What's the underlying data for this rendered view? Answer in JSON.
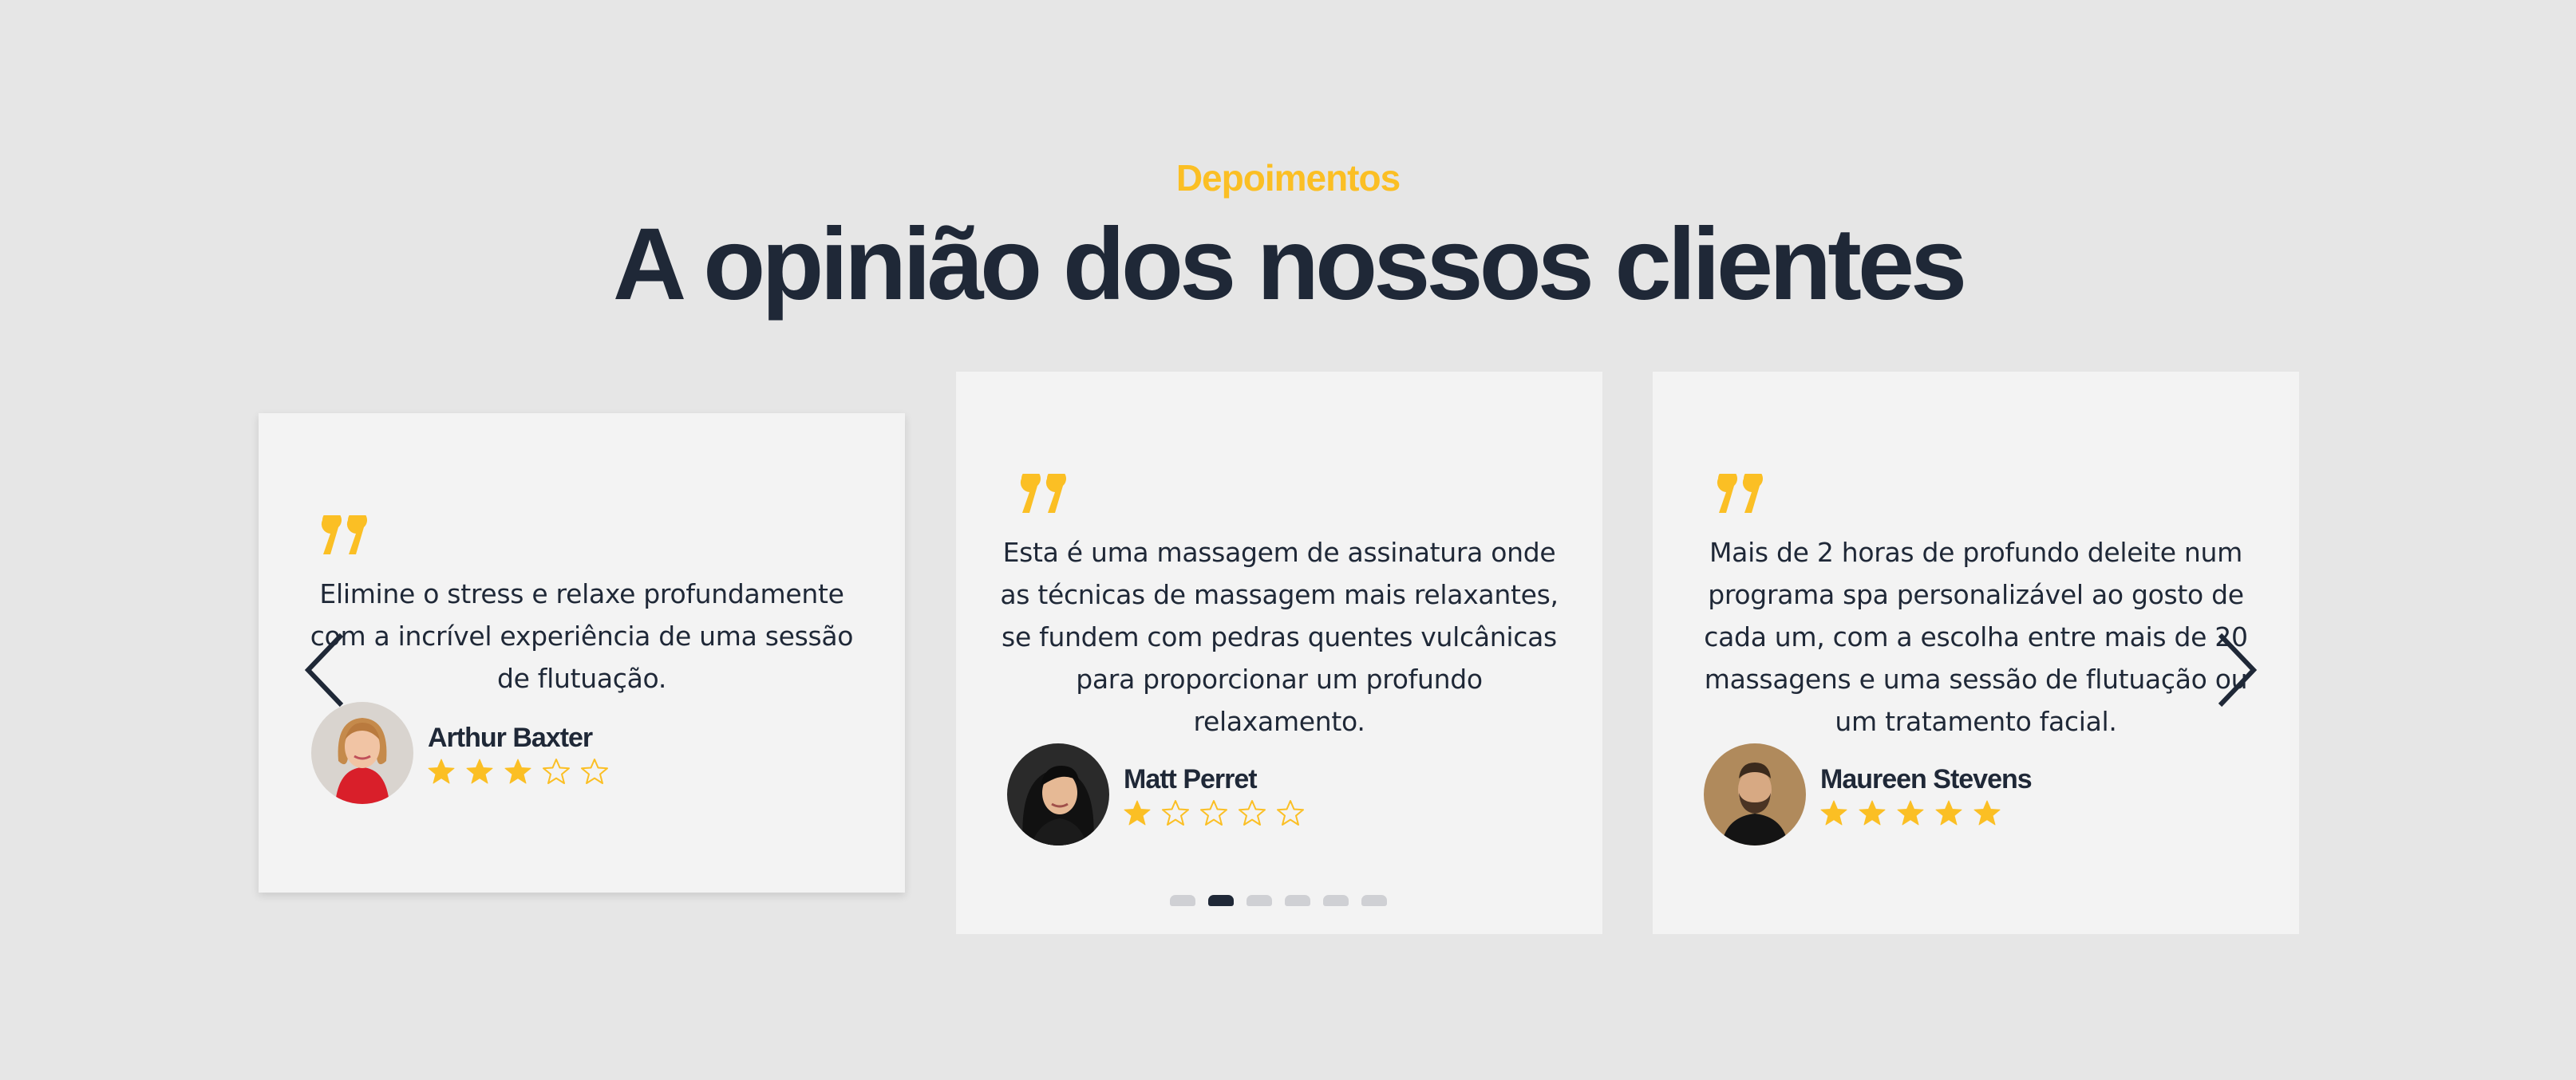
{
  "section": {
    "eyebrow": "Depoimentos",
    "title": "A opinião dos nossos clientes"
  },
  "colors": {
    "accent": "#fbbf24",
    "text": "#1f2837",
    "card": "#f3f3f3",
    "background": "#e6e6e6",
    "dot_inactive": "#cfd0d4"
  },
  "testimonials": [
    {
      "text_lines": [
        "Elimine o stress e relaxe profundamente",
        "com a incrível experiência de uma sessão",
        "de flutuação."
      ],
      "author": "Arthur Baxter",
      "rating": 3,
      "max_rating": 5,
      "avatar_icon": "woman-red-shirt-avatar"
    },
    {
      "text_lines": [
        "Esta é uma massagem de assinatura onde",
        "as técnicas de massagem mais relaxantes,",
        "se fundem com pedras quentes vulcânicas",
        "para proporcionar um profundo",
        "relaxamento."
      ],
      "author": "Matt Perret",
      "rating": 1,
      "max_rating": 5,
      "avatar_icon": "woman-dark-hair-avatar"
    },
    {
      "text_lines": [
        "Mais de 2 horas de profundo deleite num",
        "programa spa personalizável ao gosto de",
        "cada um, com a escolha entre mais de 20",
        "massagens e uma sessão de flutuação ou",
        "um tratamento facial."
      ],
      "author": "Maureen Stevens",
      "rating": 5,
      "max_rating": 5,
      "avatar_icon": "man-beard-avatar"
    }
  ],
  "carousel": {
    "slide_count": 6,
    "active_index": 1,
    "prev_icon": "chevron-left-icon",
    "next_icon": "chevron-right-icon"
  }
}
